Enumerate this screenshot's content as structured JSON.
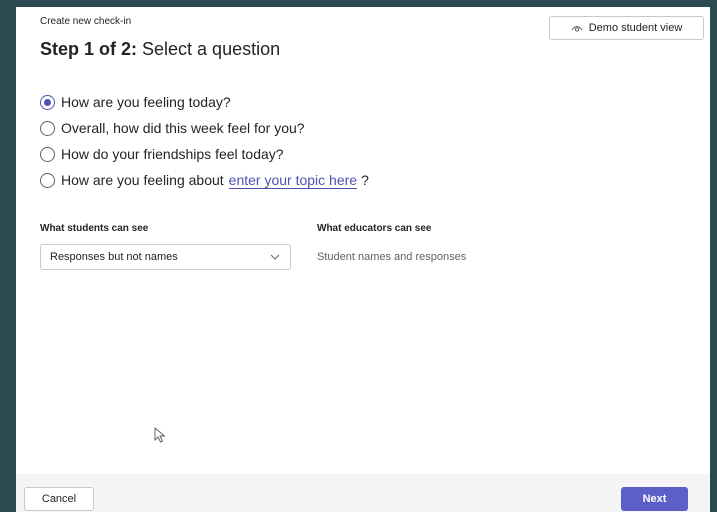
{
  "dialog": {
    "eyebrow": "Create new check-in",
    "title_strong": "Step 1 of 2:",
    "title_rest": " Select a question",
    "demo_button": {
      "label": "Demo student view",
      "icon": "eye-icon"
    }
  },
  "options": [
    {
      "label": "How are you feeling today?",
      "checked": true
    },
    {
      "label": "Overall, how did this week feel for you?",
      "checked": false
    },
    {
      "label": "How do your friendships feel today?",
      "checked": false
    },
    {
      "label": "How are you feeling about",
      "link": "enter your topic here",
      "suffix": "?",
      "checked": false
    }
  ],
  "visibility": {
    "students_label": "What students can see",
    "students_value": "Responses but not names",
    "educators_label": "What educators can see",
    "educators_value": "Student names and responses"
  },
  "footer": {
    "cancel_label": "Cancel",
    "next_label": "Next"
  },
  "colors": {
    "accent": "#5b5fc7",
    "link": "#4f52b2",
    "backdrop": "#2b4a52"
  }
}
